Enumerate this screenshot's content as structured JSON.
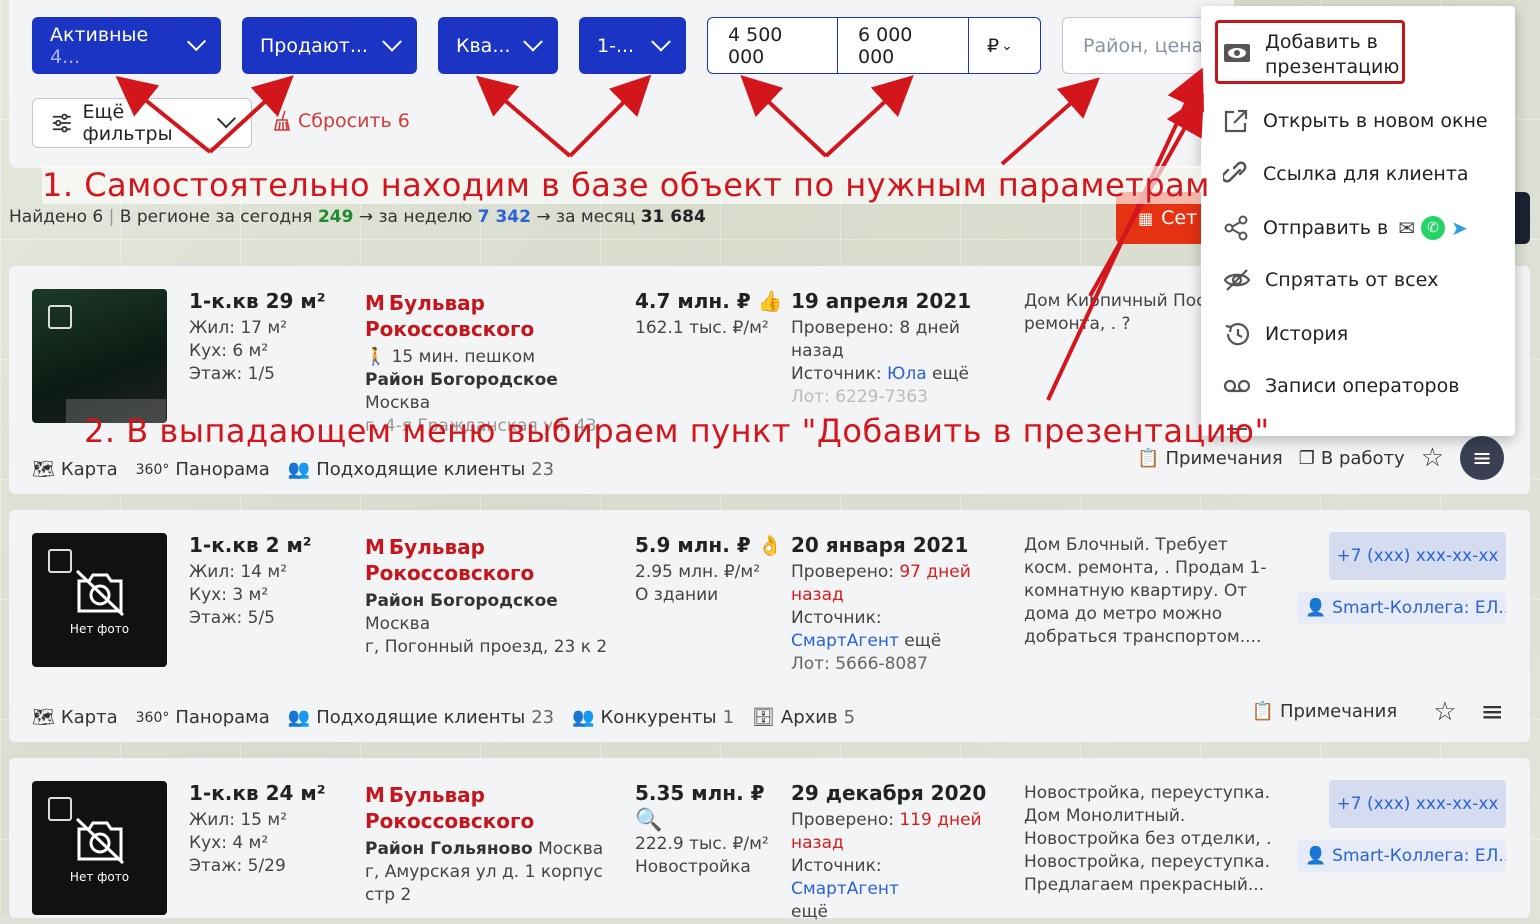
{
  "filters": {
    "status": {
      "label": "Активные",
      "extra": "4..."
    },
    "deal": "Продают...",
    "type": "Ква...",
    "rooms": "1-...",
    "price_min": "4 500 000",
    "price_max": "6 000 000",
    "currency": "₽",
    "search_placeholder": "Район, цена ₽",
    "more": "Ещё фильтры",
    "reset": "Сбросить 6"
  },
  "summary": {
    "found": "Найдено 6",
    "region_label": "В регионе за сегодня",
    "today": "249",
    "week_label": "→ за неделю",
    "week": "7 342",
    "month_label": "→ за месяц",
    "month": "31 684"
  },
  "sets_button": "Сет",
  "listings": [
    {
      "title": "1-к.кв 29 м²",
      "living": "Жил: 17 м²",
      "kitchen": "Кух: 6 м²",
      "floor": "Этаж: 1/5",
      "metro": "Бульвар Рокоссовского",
      "walk": "15 мин. пешком",
      "district": "Район Богородское",
      "city": "Москва",
      "address": "г, 4-я Гражданская ул, 43",
      "price": "4.7 млн. ₽",
      "price_m2": "162.1 тыс. ₽/м²",
      "date": "19 апреля 2021",
      "checked": "Проверено: 8 дней назад",
      "source_label": "Источник:",
      "source": "Юла",
      "source_more": "ещё",
      "lot": "Лот: 6229-7363",
      "desc": "Дом Кирпичный Пос... ремонта, . ?",
      "actions": {
        "map": "Карта",
        "panorama": "Панорама",
        "clients": "Подходящие клиенты",
        "clients_count": "23",
        "notes": "Примечания",
        "work": "В работу"
      }
    },
    {
      "title": "1-к.кв 2 м²",
      "living": "Жил: 14 м²",
      "kitchen": "Кух: 3 м²",
      "floor": "Этаж: 5/5",
      "metro": "Бульвар Рокоссовского",
      "district": "Район Богородское",
      "city": "Москва",
      "address": "г, Погонный проезд, 23 к 2",
      "no_photo": "Нет фото",
      "price": "5.9 млн. ₽",
      "price_m2": "2.95 млн. ₽/м²",
      "building": "О здании",
      "date": "20 января 2021",
      "checked_label": "Проверено:",
      "checked": "97 дней назад",
      "source_label": "Источник:",
      "source": "СмартАгент",
      "source_more": "ещё",
      "lot": "Лот: 5666-8087",
      "desc": "Дом Блочный. Требует косм. ремонта, . Продам 1-комнатную квартиру. От дома до метро можно добраться транспортом....",
      "phone": "+7 (xxx) xxx-xx-xx",
      "agent": "Smart-Коллега: ЕЛ...",
      "actions": {
        "map": "Карта",
        "panorama": "Панорама",
        "clients": "Подходящие клиенты",
        "clients_count": "23",
        "competitors": "Конкуренты",
        "competitors_count": "1",
        "archive": "Архив",
        "archive_count": "5",
        "notes": "Примечания"
      }
    },
    {
      "title": "1-к.кв 24 м²",
      "living": "Жил: 15 м²",
      "kitchen": "Кух: 4 м²",
      "floor": "Этаж: 5/29",
      "metro": "Бульвар Рокоссовского",
      "district": "Район Гольяново",
      "city": "Москва г, Амурская ул д. 1 корпус стр 2",
      "no_photo": "Нет фото",
      "price": "5.35 млн. ₽",
      "price_m2": "222.9 тыс. ₽/м²",
      "building": "Новостройка",
      "date": "29 декабря 2020",
      "checked_label": "Проверено:",
      "checked": "119 дней назад",
      "source_label": "Источник:",
      "source": "СмартАгент",
      "source_more": "ещё",
      "desc": "Новостройка, переуступка. Дом Монолитный. Новостройка без отделки, . Новостройка, переуступка. Предлагаем прекрасный...",
      "phone": "+7 (xxx) xxx-xx-xx",
      "agent": "Smart-Коллега: ЕЛ..."
    }
  ],
  "dropdown": [
    {
      "label": "Добавить в презентацию",
      "icon": "eye-icon"
    },
    {
      "label": "Открыть в новом окне",
      "icon": "external-link-icon"
    },
    {
      "label": "Ссылка для клиента",
      "icon": "link-icon"
    },
    {
      "label": "Отправить в",
      "icon": "share-icon"
    },
    {
      "label": "Спрятать от всех",
      "icon": "eye-off-icon"
    },
    {
      "label": "История",
      "icon": "history-icon"
    },
    {
      "label": "Записи операторов",
      "icon": "tape-icon"
    }
  ],
  "annotations": {
    "step1": "1. Самостоятельно находим в базе объект по нужным параметрам",
    "step2": "2. В выпадающем меню выбираем пункт \"Добавить в презентацию\""
  },
  "colors": {
    "accent": "#1b34c4",
    "metro": "#c4161c",
    "annotation": "#d3161c",
    "link": "#2b63d6"
  }
}
